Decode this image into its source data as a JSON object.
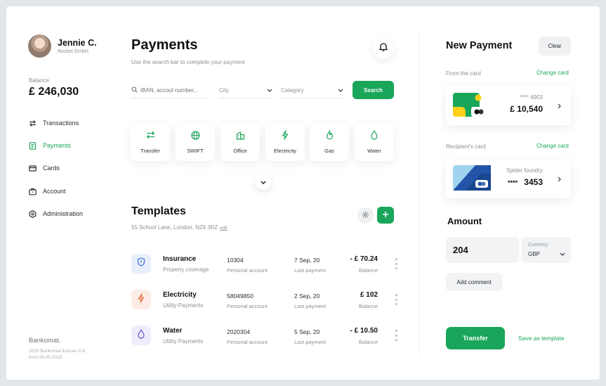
{
  "user": {
    "name": "Jennie C.",
    "company": "Rocket GmbH"
  },
  "balance": {
    "label": "Balance",
    "value": "£ 246,030"
  },
  "nav": [
    {
      "label": "Transactions",
      "icon": "arrows-swap-icon",
      "active": false
    },
    {
      "label": "Payments",
      "icon": "document-icon",
      "active": true
    },
    {
      "label": "Cards",
      "icon": "card-icon",
      "active": false
    },
    {
      "label": "Account",
      "icon": "briefcase-icon",
      "active": false
    },
    {
      "label": "Administration",
      "icon": "hexagon-settings-icon",
      "active": false
    }
  ],
  "footer": {
    "brand": "Bankomat.",
    "license": "2020 Bankomat license #19 from 06.05.2020"
  },
  "main": {
    "title": "Payments",
    "subtitle": "Use the search bar to complete your payment",
    "search": {
      "placeholder": "IBAN, accout number..."
    },
    "city": {
      "value": "City"
    },
    "category": {
      "value": "Category"
    },
    "search_button": "Search"
  },
  "categories": [
    {
      "label": "Transfer",
      "icon": "transfer-icon"
    },
    {
      "label": "SWIFT",
      "icon": "globe-icon"
    },
    {
      "label": "Office",
      "icon": "building-icon"
    },
    {
      "label": "Electricity",
      "icon": "lightning-icon"
    },
    {
      "label": "Gas",
      "icon": "flame-icon"
    },
    {
      "label": "Water",
      "icon": "drop-icon"
    }
  ],
  "templates": {
    "title": "Templates",
    "address": "55 School Lane, London, N29 3RZ",
    "edit": "edit",
    "rows": [
      {
        "name": "Insurance",
        "type": "Property coverage",
        "account": "10304",
        "account_label": "Personal account",
        "date": "7 Sep, 20",
        "date_label": "Last payment",
        "amount": "- £ 70.24",
        "amount_label": "Balance",
        "icon": "shield-icon",
        "color": "#3b6fd4",
        "bg": "#e9f0fb"
      },
      {
        "name": "Electricity",
        "type": "Utility Payments",
        "account": "58049850",
        "account_label": "Personal account",
        "date": "2 Sep, 20",
        "date_label": "Last payment",
        "amount": "£ 102",
        "amount_label": "Balance",
        "icon": "lightning-icon",
        "color": "#e56b3d",
        "bg": "#fdece5"
      },
      {
        "name": "Water",
        "type": "Utility Payments",
        "account": "2020304",
        "account_label": "Personal account",
        "date": "5 Sep, 20",
        "date_label": "Last payment",
        "amount": "- £ 10.50",
        "amount_label": "Balance",
        "icon": "drop-icon",
        "color": "#6b4fc9",
        "bg": "#efecfb"
      }
    ]
  },
  "new_payment": {
    "title": "New Payment",
    "clear": "Clear",
    "from_label": "From the card",
    "change_card": "Change card",
    "from_card": {
      "number": "**** 4903",
      "amount": "£ 10,540"
    },
    "recipient_label": "Recipient's card",
    "recipient_card": {
      "name": "Spider foundry",
      "mask": "****",
      "number": "3453"
    },
    "amount_title": "Amount",
    "amount_value": "204",
    "currency_label": "Currency",
    "currency_value": "GBP",
    "add_comment": "Add comment",
    "transfer": "Transfer",
    "save_template": "Save as template"
  },
  "colors": {
    "accent": "#1aa65a",
    "text": "#111111",
    "muted": "#8b9096"
  }
}
